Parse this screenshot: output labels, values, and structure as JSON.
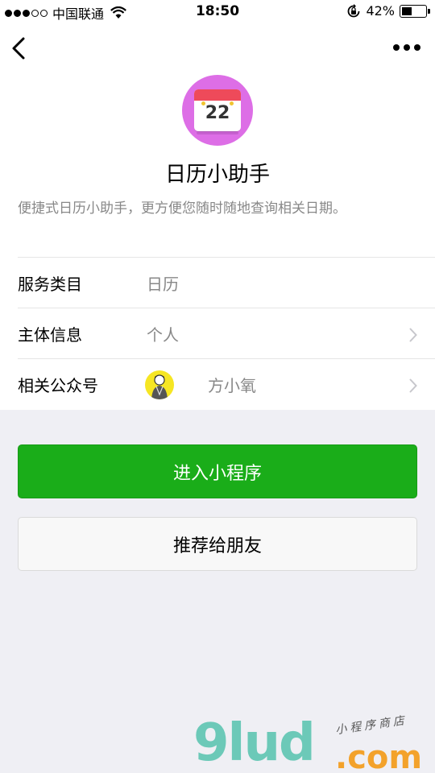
{
  "status_bar": {
    "carrier": "中国联通",
    "time": "18:50",
    "battery": "42%",
    "battery_level": 0.42
  },
  "app": {
    "logo_day": "22",
    "name": "日历小助手",
    "description": "便捷式日历小助手，更方便您随时随地查询相关日期。"
  },
  "info": {
    "category_label": "服务类目",
    "category_value": "日历",
    "entity_label": "主体信息",
    "entity_value": "个人",
    "official_label": "相关公众号",
    "official_value": "方小氧"
  },
  "buttons": {
    "enter_label": "进入小程序",
    "share_label": "推荐给朋友"
  },
  "colors": {
    "accent_green": "#1aad19",
    "logo_bg": "#dd6ee6"
  },
  "watermark": {
    "main": "9lud",
    "domain": ".com",
    "tagline": "小程序商店"
  }
}
